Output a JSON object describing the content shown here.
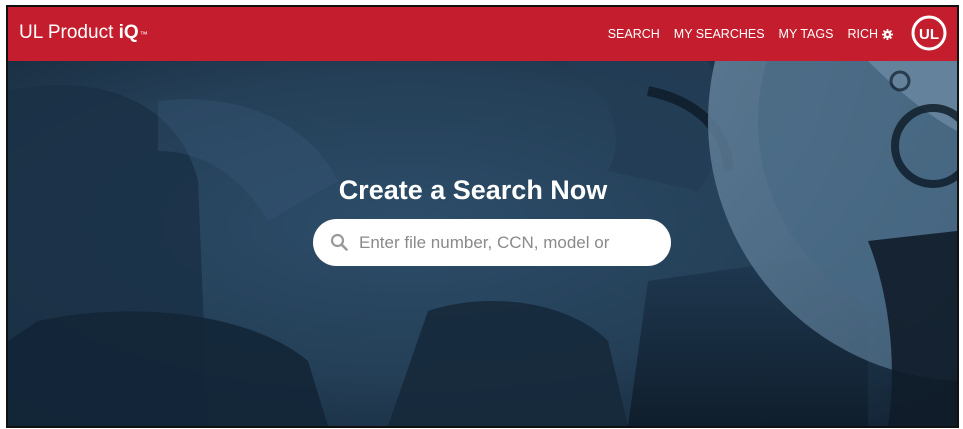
{
  "header": {
    "brand_prefix": "UL Product ",
    "brand_iq": "iQ",
    "brand_tm": "™",
    "background_color": "#c41e2e",
    "nav": {
      "search": "SEARCH",
      "my_searches": "MY SEARCHES",
      "my_tags": "MY TAGS",
      "user": "RICH",
      "user_icon": "gear-icon"
    },
    "logo_text": "UL",
    "logo_icon": "ul-logo-icon"
  },
  "hero": {
    "title": "Create a Search Now",
    "search": {
      "placeholder": "Enter file number, CCN, model or",
      "value": "",
      "icon": "search-icon"
    }
  }
}
